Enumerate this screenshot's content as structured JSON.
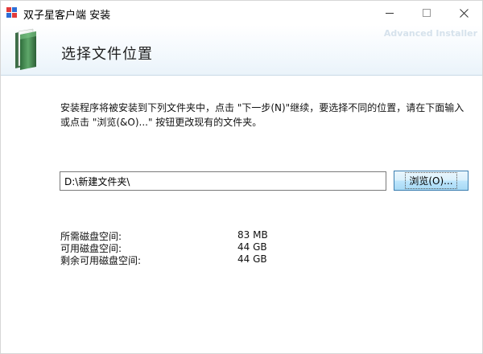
{
  "window": {
    "title": "双子星客户端 安装",
    "app_icon_colors": [
      "#e23b3b",
      "#2d6fd6",
      "#e23b3b",
      "#2d6fd6"
    ]
  },
  "header": {
    "title": "选择文件位置",
    "brand": "Advanced Installer",
    "icon": "folder-icon"
  },
  "description": "安装程序将被安装到下列文件夹中，点击 \"下一步(N)\"继续，要选择不同的位置，请在下面输入或点击 \"浏览(&O)...\" 按钮更改现有的文件夹。",
  "path": {
    "value": "D:\\新建文件夹\\"
  },
  "browse_button": {
    "label": "浏览(O)..."
  },
  "disk_space": [
    {
      "label": "所需磁盘空间:",
      "value": "83 MB"
    },
    {
      "label": "可用磁盘空间:",
      "value": "44 GB"
    },
    {
      "label": "剩余可用磁盘空间:",
      "value": "44 GB"
    }
  ]
}
